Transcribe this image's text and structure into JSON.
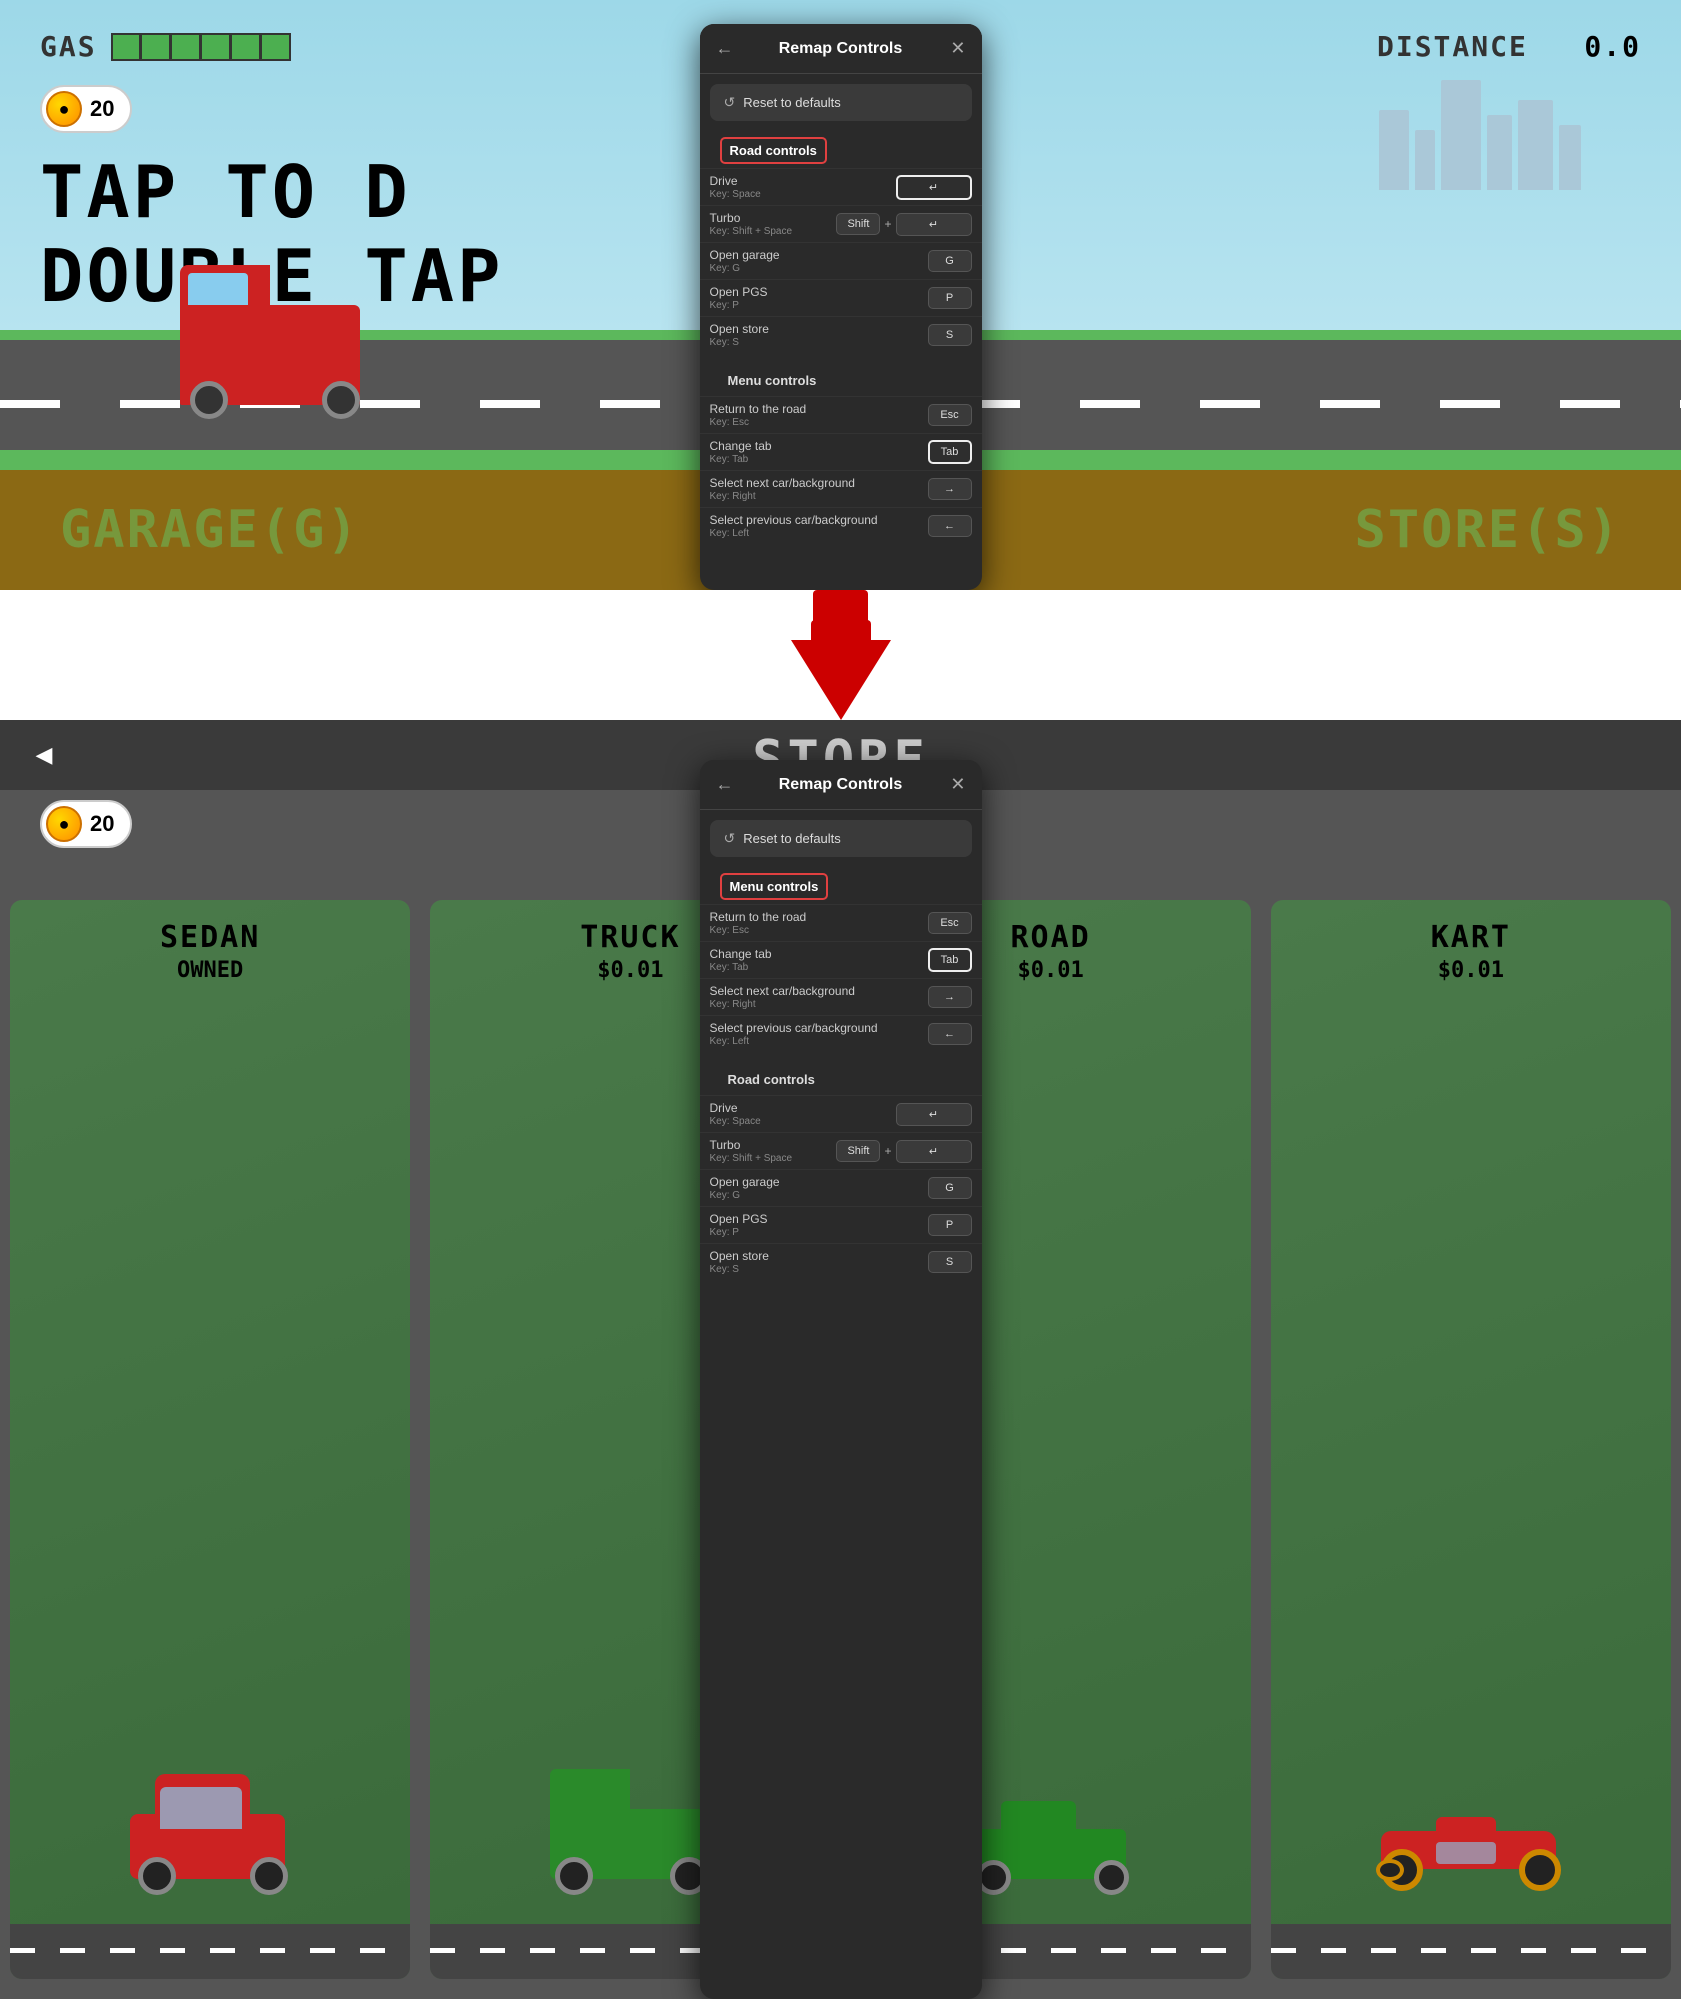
{
  "top_section": {
    "gas_label": "GAS",
    "distance_label": "DISTANCE",
    "distance_value": "0.0",
    "coin_count": "20",
    "tap_text": "TAP TO D",
    "tap_text2": "DOUBLE TAP",
    "corner_left": "GARAGE(G)",
    "corner_right": "STORE(S)"
  },
  "modal_top": {
    "title": "Remap Controls",
    "reset_label": "Reset to defaults",
    "road_section": "Road controls",
    "menu_section": "Menu controls",
    "controls": {
      "drive": {
        "name": "Drive",
        "key_hint": "Key: Space",
        "keys": [
          "↵"
        ]
      },
      "turbo": {
        "name": "Turbo",
        "key_hint": "Key: Shift + Space",
        "keys": [
          "Shift",
          "↵"
        ]
      },
      "open_garage": {
        "name": "Open garage",
        "key_hint": "Key: G",
        "keys": [
          "G"
        ]
      },
      "open_pgs": {
        "name": "Open PGS",
        "key_hint": "Key: P",
        "keys": [
          "P"
        ]
      },
      "open_store": {
        "name": "Open store",
        "key_hint": "Key: S",
        "keys": [
          "S"
        ]
      },
      "return_road": {
        "name": "Return to the road",
        "key_hint": "Key: Esc",
        "keys": [
          "Esc"
        ]
      },
      "change_tab": {
        "name": "Change tab",
        "key_hint": "Key: Tab",
        "keys": [
          "Tab"
        ]
      },
      "select_next": {
        "name": "Select next car/background",
        "key_hint": "Key: Right",
        "keys": [
          "→"
        ]
      },
      "select_prev": {
        "name": "Select previous car/background",
        "key_hint": "Key: Left",
        "keys": [
          "←"
        ]
      }
    }
  },
  "bottom_section": {
    "store_title": "STORE",
    "coin_count": "20",
    "cards": [
      {
        "label": "SEDAN",
        "sub": "OWNED",
        "id": "sedan"
      },
      {
        "label": "TRUCK",
        "sub": "$0.01",
        "id": "truck"
      },
      {
        "label": "ROAD",
        "sub": "$0.01",
        "id": "road"
      },
      {
        "label": "KART",
        "sub": "$0.01",
        "id": "kart"
      }
    ]
  },
  "modal_bottom": {
    "title": "Remap Controls",
    "reset_label": "Reset to defaults",
    "menu_section": "Menu controls",
    "road_section": "Road controls",
    "controls": {
      "return_road": {
        "name": "Return to the road",
        "key_hint": "Key: Esc",
        "keys": [
          "Esc"
        ]
      },
      "change_tab": {
        "name": "Change tab",
        "key_hint": "Key: Tab",
        "keys": [
          "Tab"
        ]
      },
      "select_next": {
        "name": "Select next car/background",
        "key_hint": "Key: Right",
        "keys": [
          "→"
        ]
      },
      "select_prev": {
        "name": "Select previous car/background",
        "key_hint": "Key: Left",
        "keys": [
          "←"
        ]
      },
      "drive": {
        "name": "Drive",
        "key_hint": "Key: Space",
        "keys": [
          "↵"
        ]
      },
      "turbo": {
        "name": "Turbo",
        "key_hint": "Key: Shift + Space",
        "keys": [
          "Shift",
          "↵"
        ]
      },
      "open_garage": {
        "name": "Open garage",
        "key_hint": "Key: G",
        "keys": [
          "G"
        ]
      },
      "open_pgs": {
        "name": "Open PGS",
        "key_hint": "Key: P",
        "keys": [
          "P"
        ]
      },
      "open_store": {
        "name": "Open store",
        "key_hint": "Key: S",
        "keys": [
          "S"
        ]
      }
    }
  },
  "icons": {
    "back": "←",
    "close": "✕",
    "reset": "↺",
    "arrow_right": "→",
    "arrow_left": "←",
    "plus": "+"
  }
}
